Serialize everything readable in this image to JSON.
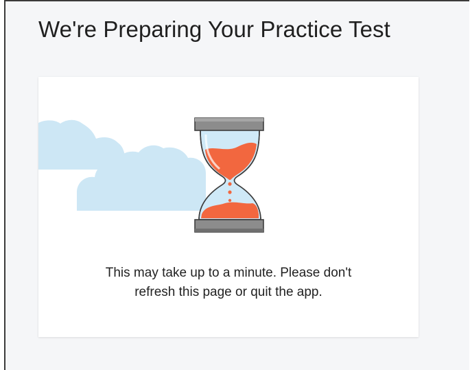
{
  "page": {
    "title": "We're Preparing Your Practice Test"
  },
  "card": {
    "message_line1": "This may take up to a minute. Please don't",
    "message_line2": "refresh this page or quit the app.",
    "illustration_icon": "hourglass-icon",
    "decoration_icon": "cloud-icon"
  },
  "colors": {
    "background": "#f5f6f8",
    "card": "#ffffff",
    "cloud": "#cde7f5",
    "glass": "#cfe9f7",
    "sand": "#f2673f",
    "hourglass_frame": "#8a8a8a"
  }
}
